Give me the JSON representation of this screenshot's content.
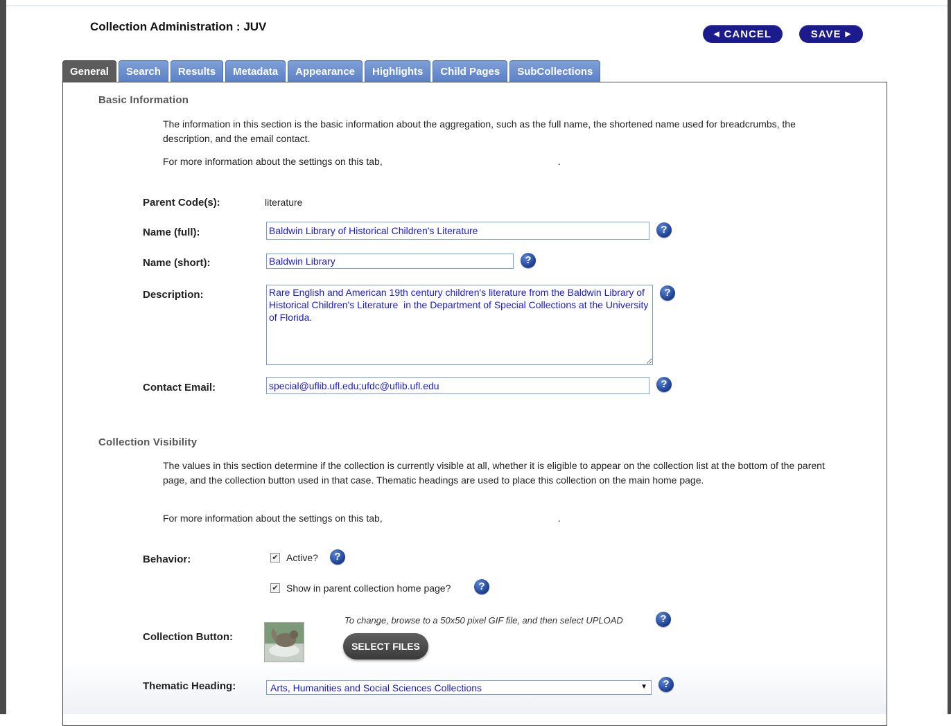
{
  "page_title": "Collection Administration : JUV",
  "buttons": {
    "cancel": "CANCEL",
    "save": "SAVE"
  },
  "tabs": [
    "General",
    "Search",
    "Results",
    "Metadata",
    "Appearance",
    "Highlights",
    "Child Pages",
    "SubCollections"
  ],
  "active_tab": "General",
  "basic": {
    "heading": "Basic Information",
    "description": "The information in this section is the basic information about the aggregation, such as the full name, the shortened name used for breadcrumbs, the description, and the email contact.",
    "more_info": "For more information about the settings on this tab,",
    "more_info_end": ".",
    "parent_label": "Parent Code(s):",
    "parent_value": "literature",
    "name_full_label": "Name (full):",
    "name_full_value": "Baldwin Library of Historical Children's Literature",
    "name_short_label": "Name (short):",
    "name_short_value": "Baldwin Library",
    "description_label": "Description:",
    "description_value": "Rare English and American 19th century children's literature from the Baldwin Library of Historical Children's Literature  in the Department of Special Collections at the University of Florida.",
    "email_label": "Contact Email:",
    "email_value": "special@uflib.ufl.edu;ufdc@uflib.ufl.edu"
  },
  "visibility": {
    "heading": "Collection Visibility",
    "description": "The values in this section determine if the collection is currently visible at all, whether it is eligible to appear on the collection list at the bottom of the parent page, and the collection button used in that case. Thematic headings are used to place this collection on the main home page.",
    "more_info": "For more information about the settings on this tab,",
    "more_info_end": ".",
    "behavior_label": "Behavior:",
    "active_label": "Active?",
    "active_checked": true,
    "show_parent_label": "Show in parent collection home page?",
    "show_parent_checked": true,
    "button_label": "Collection Button:",
    "upload_hint": "To change, browse to a 50x50 pixel GIF file, and then select UPLOAD",
    "select_files": "SELECT FILES",
    "thematic_label": "Thematic Heading:",
    "thematic_value": "Arts, Humanities and Social Sciences Collections"
  },
  "help_glyph": "?",
  "colors": {
    "accent": "#1b1b8e",
    "tab": "#5b80c5",
    "active_tab": "#5c5c5c",
    "input_text": "#1a1acc"
  }
}
